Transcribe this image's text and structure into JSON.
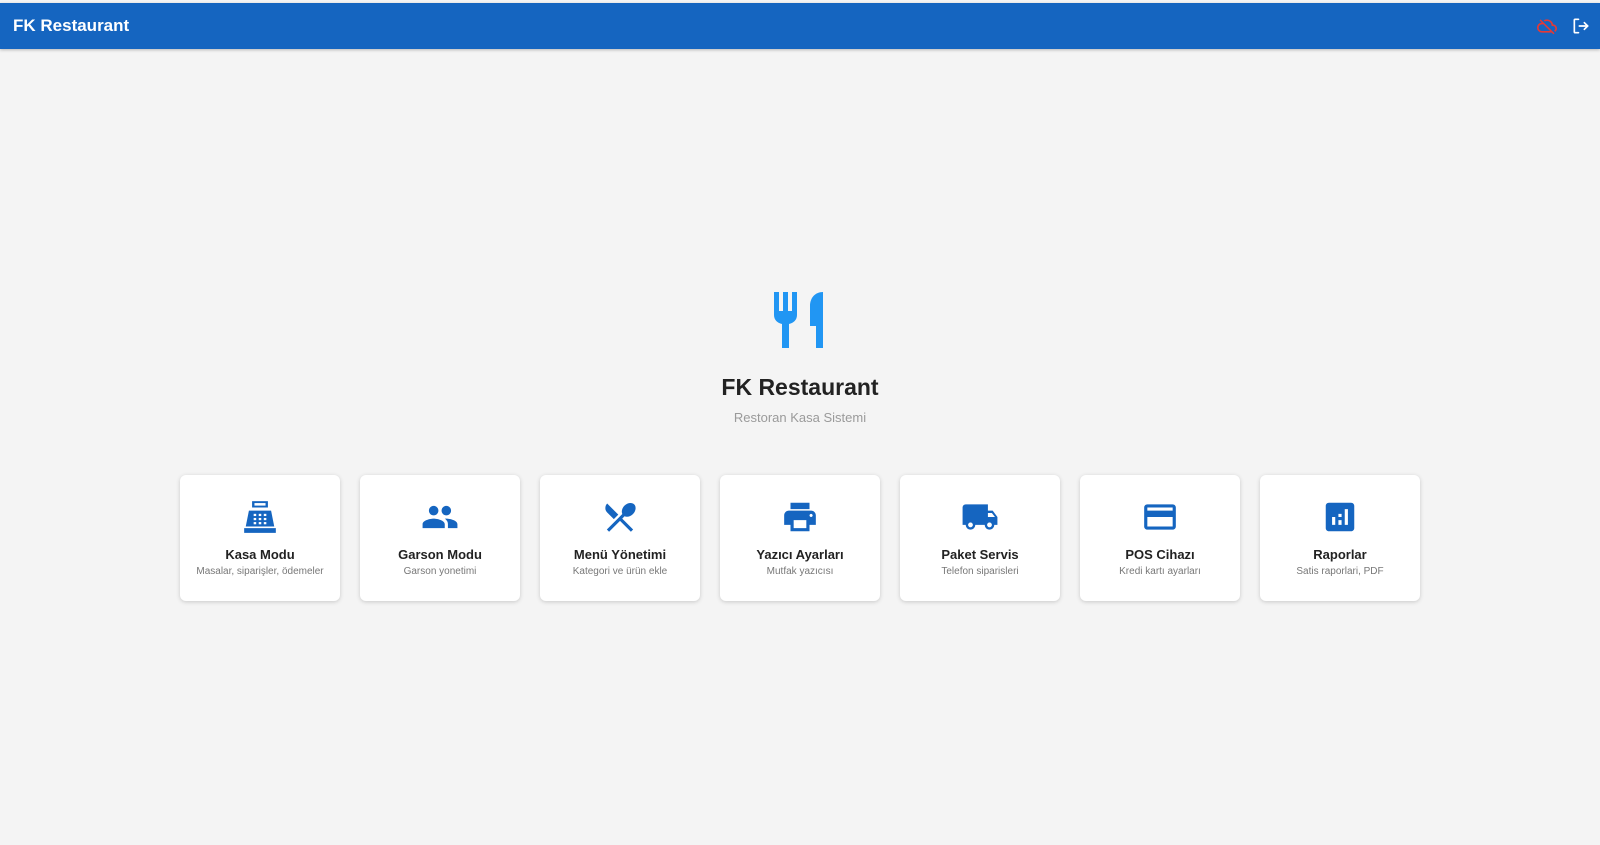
{
  "appbar": {
    "title": "FK Restaurant",
    "offline_icon": "cloud-off-icon",
    "logout_icon": "logout-icon"
  },
  "hero": {
    "icon": "restaurant-icon",
    "title": "FK Restaurant",
    "subtitle": "Restoran Kasa Sistemi"
  },
  "cards": [
    {
      "icon": "cash-register-icon",
      "title": "Kasa Modu",
      "desc": "Masalar, siparişler, ödemeler"
    },
    {
      "icon": "people-icon",
      "title": "Garson Modu",
      "desc": "Garson yonetimi"
    },
    {
      "icon": "utensils-icon",
      "title": "Menü Yönetimi",
      "desc": "Kategori ve ürün ekle"
    },
    {
      "icon": "printer-icon",
      "title": "Yazıcı Ayarları",
      "desc": "Mutfak yazıcısı"
    },
    {
      "icon": "truck-icon",
      "title": "Paket Servis",
      "desc": "Telefon siparisleri"
    },
    {
      "icon": "credit-card-icon",
      "title": "POS Cihazı",
      "desc": "Kredi kartı ayarları"
    },
    {
      "icon": "bar-chart-icon",
      "title": "Raporlar",
      "desc": "Satis raporlari, PDF"
    }
  ],
  "colors": {
    "primary": "#1565c0",
    "hero_icon": "#2196f3",
    "offline": "#e53935",
    "background": "#f4f4f4"
  }
}
